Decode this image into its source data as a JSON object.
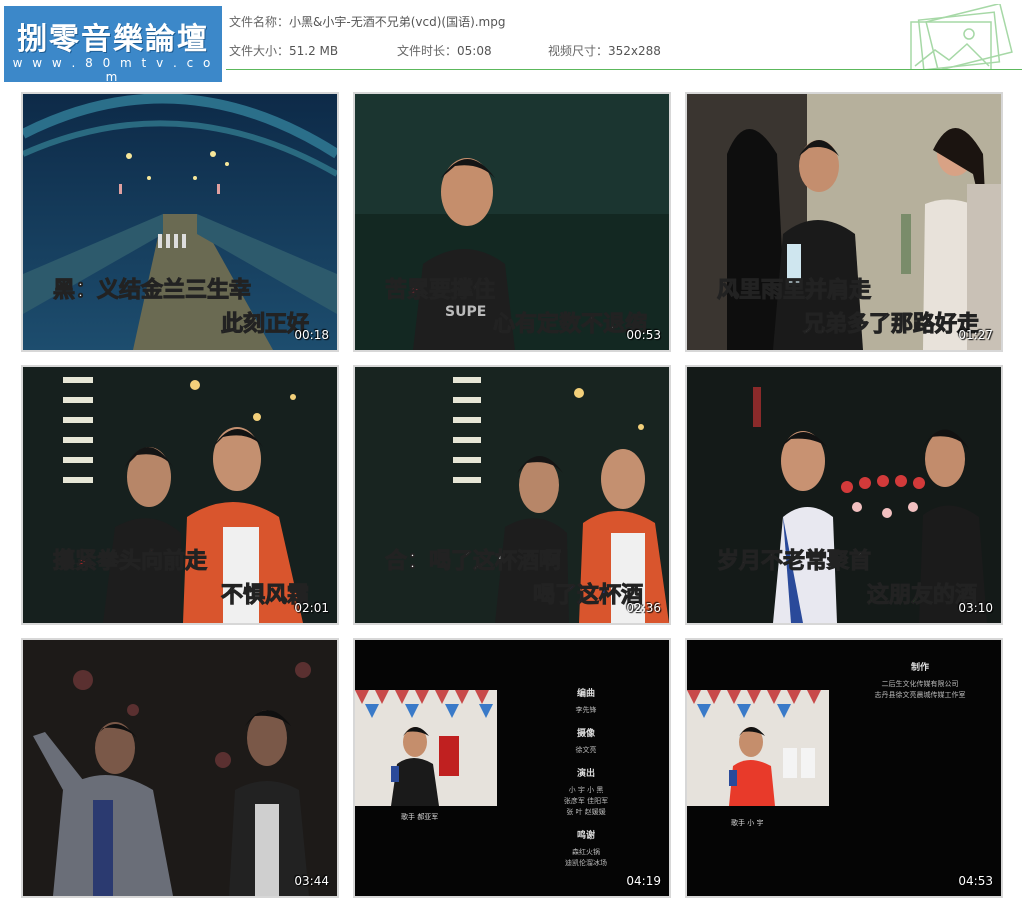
{
  "header": {
    "logo_title": "捌零音樂論壇",
    "logo_url": "w w w . 8 0 m t v . c o m",
    "file_name_label": "文件名称：",
    "file_name": "小黑&小宇-无酒不兄弟(vcd)(国语).mpg",
    "file_size_label": "文件大小：",
    "file_size": "51.2 MB",
    "duration_label": "文件时长：",
    "duration": "05:08",
    "dimensions_label": "视频尺寸：",
    "dimensions": "352x288"
  },
  "thumbnails": [
    {
      "time": "00:18",
      "lyric1_a": "黑",
      "lyric1_b": "：义结金兰三生幸",
      "lyric2": "此刻正好"
    },
    {
      "time": "00:53",
      "lyric1_a": "苦",
      "lyric1_b": "累",
      "lyric1_c": "要撑住",
      "lyric2": "心有定数不退缩",
      "shirt": "SUPE"
    },
    {
      "time": "01:27",
      "lyric1": "风里雨里",
      "lyric1_b": "并肩走",
      "lyric2": "兄弟多了那路好走"
    },
    {
      "time": "02:01",
      "lyric1": "攥紧拳头向前走",
      "lyric2": "不惧风霜"
    },
    {
      "time": "02:36",
      "lyric1_a": "合",
      "lyric1_b": "：喝了这杯酒啊",
      "lyric2": "喝了这杯酒"
    },
    {
      "time": "03:10",
      "lyric1": "岁月不老常聚首",
      "lyric2": "这朋友的酒"
    },
    {
      "time": "03:44"
    },
    {
      "time": "04:19",
      "singer_caption": "歌手  郝亚军",
      "credits": [
        {
          "heading": "编曲",
          "names": "李先锋"
        },
        {
          "heading": "摄像",
          "names": "徐文亮"
        },
        {
          "heading": "演出",
          "names": "小  宇   小  黑\n张彦军   佳阳军\n张  叶   赵媛媛"
        },
        {
          "heading": "鸣谢",
          "names": "森红火锅\n迪凯伦溜冰场"
        }
      ]
    },
    {
      "time": "04:53",
      "singer_caption": "歌手   小  宇",
      "credits": [
        {
          "heading": "制作",
          "names": "二后生文化传媒有限公司\n志丹县徐文亮晨城传媒工作室"
        }
      ]
    }
  ]
}
